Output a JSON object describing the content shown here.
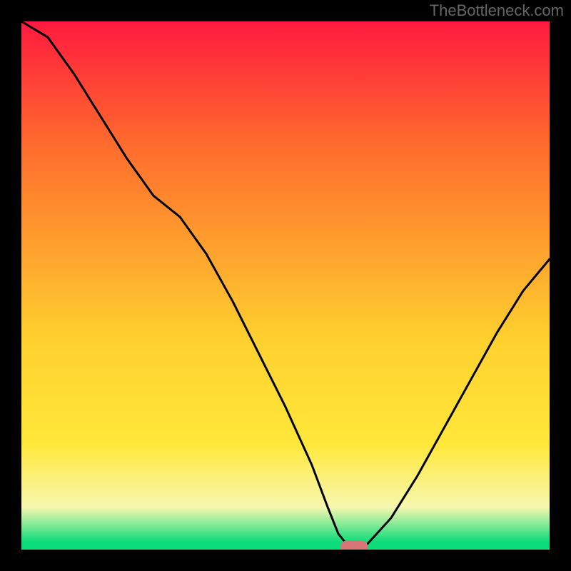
{
  "watermark": "TheBottleneck.com",
  "colors": {
    "frame": "#000000",
    "curve": "#000000",
    "marker_fill": "#d77676",
    "gradient_top": "#ff1a3f",
    "gradient_mid1": "#ff6a2d",
    "gradient_mid2": "#ffd02e",
    "gradient_yellow": "#ffe83a",
    "gradient_pale": "#f7f7b0",
    "gradient_green": "#0ddc7a"
  },
  "chart_data": {
    "type": "line",
    "title": "",
    "xlabel": "",
    "ylabel": "",
    "xlim": [
      0,
      100
    ],
    "ylim": [
      0,
      100
    ],
    "marker": {
      "x": 63,
      "y": 0.5,
      "rx": 2.6,
      "ry": 1.2
    },
    "series": [
      {
        "name": "bottleneck-curve",
        "x": [
          0,
          5,
          10,
          15,
          20,
          25,
          30,
          35,
          40,
          45,
          50,
          55,
          58,
          60,
          62,
          65,
          70,
          75,
          80,
          85,
          90,
          95,
          100
        ],
        "values": [
          105,
          97,
          90,
          82,
          74,
          67,
          63,
          56,
          47,
          37,
          27,
          16,
          8,
          3,
          0.5,
          0.5,
          6,
          14,
          23,
          32,
          41,
          49,
          55
        ]
      }
    ],
    "background_bands": [
      {
        "y0": 100,
        "y1": 77,
        "from": "gradient_top",
        "to": "gradient_mid1"
      },
      {
        "y0": 77,
        "y1": 40,
        "from": "gradient_mid1",
        "to": "gradient_mid2"
      },
      {
        "y0": 40,
        "y1": 20,
        "from": "gradient_mid2",
        "to": "gradient_yellow"
      },
      {
        "y0": 20,
        "y1": 8,
        "from": "gradient_yellow",
        "to": "gradient_pale"
      },
      {
        "y0": 8,
        "y1": 1.5,
        "from": "gradient_pale",
        "to": "gradient_green"
      },
      {
        "y0": 1.5,
        "y1": 0,
        "from": "gradient_green",
        "to": "gradient_green"
      }
    ]
  }
}
